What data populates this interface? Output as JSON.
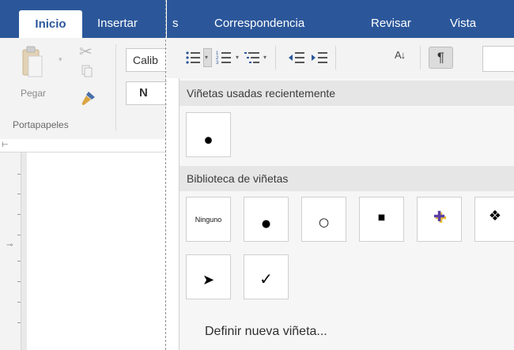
{
  "ribbon": {
    "tabs": {
      "inicio": "Inicio",
      "insertar": "Insertar",
      "fragment": "s",
      "correspondencia": "Correspondencia",
      "revisar": "Revisar",
      "vista": "Vista"
    },
    "clipboard": {
      "paste_label": "Pegar",
      "group_label": "Portapapeles"
    },
    "font": {
      "font_name": "Calib",
      "bold_label": "N"
    },
    "paragraph": {
      "sort_icon_text": "A↓",
      "pilcrow": "¶"
    },
    "accent_color": "#2b579a"
  },
  "bullet_menu": {
    "recent_header": "Viñetas usadas recientemente",
    "library_header": "Biblioteca de viñetas",
    "recent_items": [
      "•"
    ],
    "library_items": [
      "Ninguno",
      "●",
      "○",
      "■",
      "✚",
      "❖",
      "➤",
      "✓"
    ],
    "define_new": "Definir nueva viñeta..."
  }
}
